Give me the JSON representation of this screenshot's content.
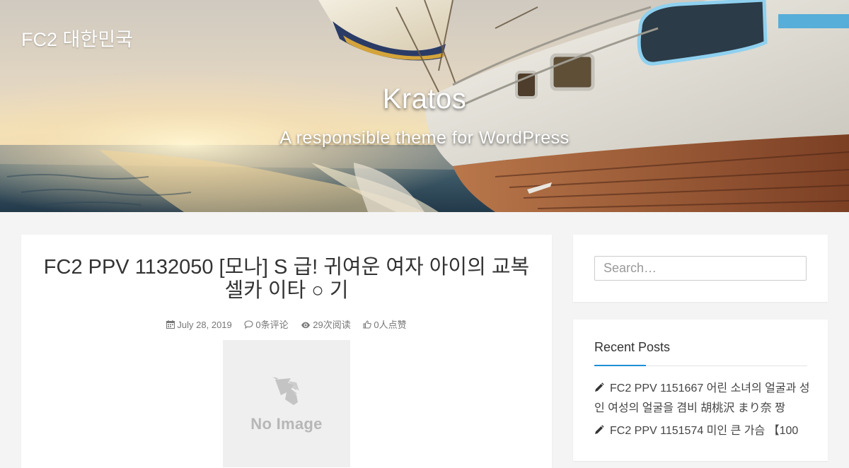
{
  "header": {
    "site_name": "FC2 대한민국",
    "title": "Kratos",
    "subtitle": "A responsible theme for WordPress"
  },
  "article": {
    "title": "FC2 PPV 1132050 [모나] S 급! 귀여운 여자 아이의 교복 셀카 이타 ○ 기",
    "meta": {
      "date": "July 28, 2019",
      "comments": "0条评论",
      "views": "29次阅读",
      "likes": "0人点赞"
    },
    "thumbnail_text": "No Image"
  },
  "sidebar": {
    "search": {
      "placeholder": "Search…"
    },
    "recent_posts": {
      "title": "Recent Posts",
      "items": [
        "FC2 PPV 1151667 어린 소녀의 얼굴과 성인 여성의 얼굴을 겸비 胡桃沢 まり奈 짱",
        "FC2 PPV 1151574 미인 큰 가슴 【100"
      ]
    }
  },
  "colors": {
    "accent": "#1e8fd6",
    "page_background": "#f4f4f4",
    "card_background": "#ffffff"
  },
  "icons": {
    "date": "calendar-icon",
    "comments": "comment-icon",
    "views": "eye-icon",
    "likes": "thumbs-up-icon",
    "post": "pencil-icon",
    "thumbnail": "unicorn-icon"
  }
}
